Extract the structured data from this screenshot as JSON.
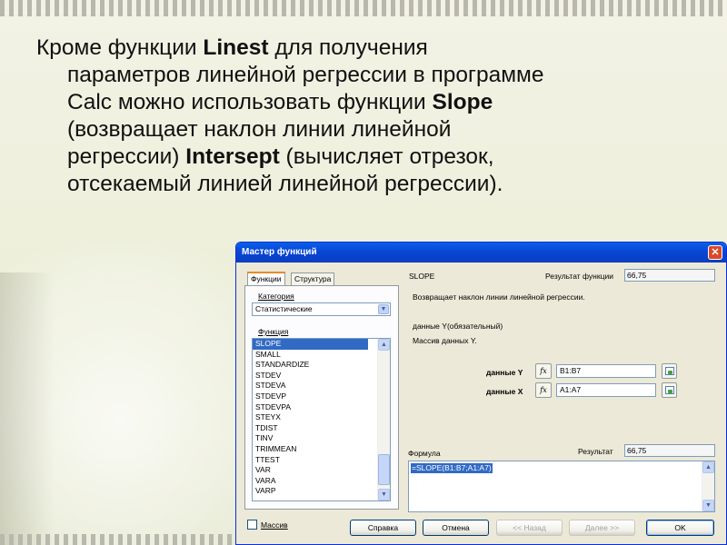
{
  "slide": {
    "line1_a": "Кроме функции ",
    "line1_b": "Linest",
    "line1_c": " для получения",
    "line2": "параметров линейной регрессии в программе",
    "line3_a": "Calc можно использовать функции ",
    "line3_b": "Slope",
    "line4": "(возвращает наклон линии линейной",
    "line5_a": "регрессии) ",
    "line5_b": "Intersept",
    "line5_c": " (вычисляет отрезок,",
    "line6": "отсекаемый линией линейной регрессии)."
  },
  "dialog": {
    "title": "Мастер функций",
    "close_glyph": "✕",
    "tabs": [
      "Функции",
      "Структура"
    ],
    "category_label": "Категория",
    "category_value": "Статистические",
    "function_label": "Функция",
    "functions": [
      "SLOPE",
      "SMALL",
      "STANDARDIZE",
      "STDEV",
      "STDEVA",
      "STDEVP",
      "STDEVPA",
      "STEYX",
      "TDIST",
      "TINV",
      "TRIMMEAN",
      "TTEST",
      "VAR",
      "VARA",
      "VARP"
    ],
    "selected_function": "SLOPE",
    "func_name": "SLOPE",
    "result_label": "Результат функции",
    "result_value": "66,75",
    "description": "Возвращает наклон линии линейной регрессии.",
    "param_desc": "данные Y(обязательный)",
    "param_desc2": "Массив данных Y.",
    "data_y_label": "данные Y",
    "data_y_value": "B1:B7",
    "data_x_label": "данные X",
    "data_x_value": "A1:A7",
    "fx": "fx",
    "formula_label": "Формула",
    "result2_label": "Результат",
    "result2_value": "66,75",
    "formula_value": "=SLOPE(B1:B7;A1:A7)",
    "array_label": "Массив",
    "buttons": {
      "help": "Справка",
      "cancel": "Отмена",
      "back": "<< Назад",
      "next": "Далее >>",
      "ok": "OK"
    }
  }
}
